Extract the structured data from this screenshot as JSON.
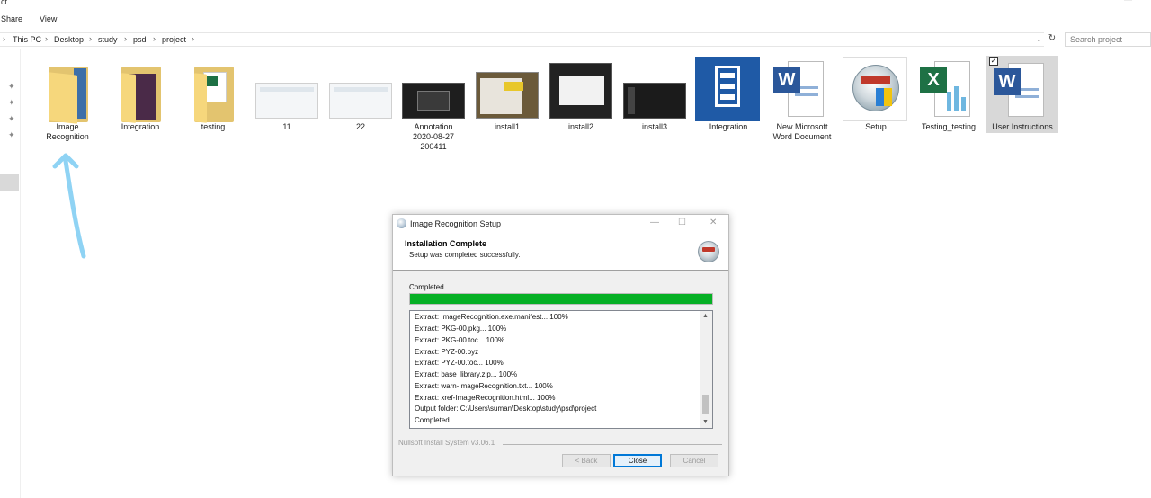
{
  "window": {
    "top_fragment": "ct",
    "minimize_glyph": "—"
  },
  "menu": {
    "share": "Share",
    "view": "View"
  },
  "address_bar": {
    "nav_arrow": "›",
    "crumbs": [
      "This PC",
      "Desktop",
      "study",
      "psd",
      "project"
    ],
    "dropdown_glyph": "⌄",
    "refresh_glyph": "↻"
  },
  "search": {
    "placeholder": "Search project"
  },
  "left_pane": {
    "pin_icons": [
      "pin-icon",
      "pin-icon",
      "pin-icon",
      "pin-icon"
    ]
  },
  "files": [
    {
      "label": "Image\nRecognition",
      "icon": "folder-icon"
    },
    {
      "label": "Integration",
      "icon": "folder-icon"
    },
    {
      "label": "testing",
      "icon": "folder-icon"
    },
    {
      "label": "11",
      "icon": "image-thumbnail-icon"
    },
    {
      "label": "22",
      "icon": "image-thumbnail-icon"
    },
    {
      "label": "Annotation\n2020-08-27\n200411",
      "icon": "image-thumbnail-icon"
    },
    {
      "label": "install1",
      "icon": "image-thumbnail-icon"
    },
    {
      "label": "install2",
      "icon": "image-thumbnail-icon"
    },
    {
      "label": "install3",
      "icon": "image-thumbnail-icon"
    },
    {
      "label": "Integration",
      "icon": "winzip-icon"
    },
    {
      "label": "New Microsoft\nWord Document",
      "icon": "word-document-icon"
    },
    {
      "label": "Setup",
      "icon": "nsis-setup-icon"
    },
    {
      "label": "Testing_testing",
      "icon": "excel-document-icon"
    },
    {
      "label": "User Instructions",
      "icon": "word-document-icon",
      "selected": true
    }
  ],
  "dialog": {
    "title": "Image Recognition Setup",
    "window_controls": {
      "minimize": "—",
      "maximize": "☐",
      "close": "✕"
    },
    "header_title": "Installation Complete",
    "header_subtitle": "Setup was completed successfully.",
    "status_label": "Completed",
    "progress_fraction": 1.0,
    "progress_color": "#06b025",
    "log_lines": [
      "Extract: ImageRecognition.exe.manifest... 100%",
      "Extract: PKG-00.pkg... 100%",
      "Extract: PKG-00.toc... 100%",
      "Extract: PYZ-00.pyz",
      "Extract: PYZ-00.toc... 100%",
      "Extract: base_library.zip... 100%",
      "Extract: warn-ImageRecognition.txt... 100%",
      "Extract: xref-ImageRecognition.html... 100%",
      "Output folder: C:\\Users\\suman\\Desktop\\study\\psd\\project",
      "Completed"
    ],
    "scroll_up": "▲",
    "scroll_down": "▼",
    "branding": "Nullsoft Install System v3.06.1",
    "buttons": {
      "back": "< Back",
      "close": "Close",
      "cancel": "Cancel"
    }
  },
  "annotation_color": "#8fd3f4"
}
